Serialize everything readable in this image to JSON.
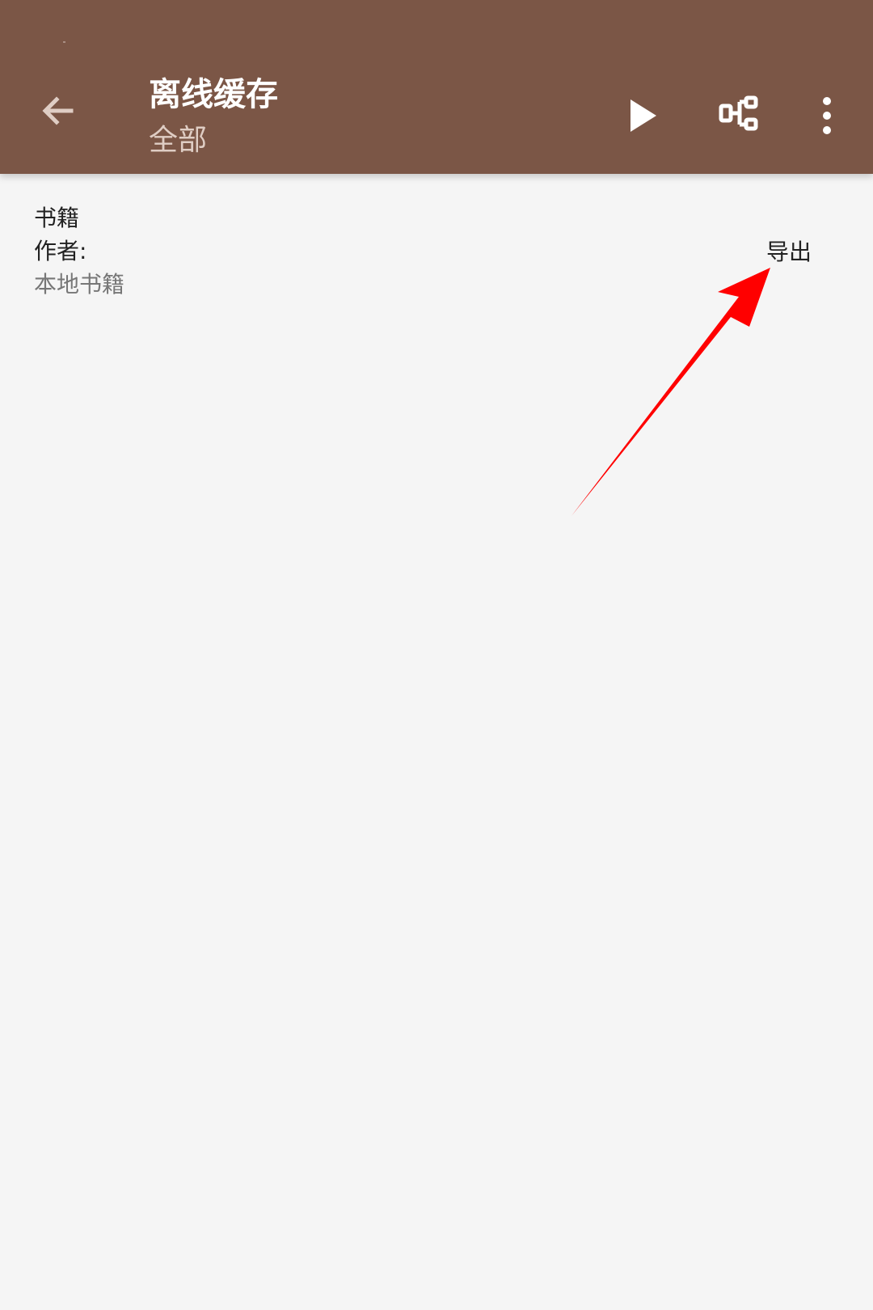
{
  "appbar": {
    "title": "离线缓存",
    "subtitle": "全部"
  },
  "actions": {
    "back_icon": "arrow-left-icon",
    "play_icon": "play-icon",
    "group_icon": "tree-icon",
    "more_icon": "more-vertical-icon"
  },
  "books": [
    {
      "name": "书籍",
      "author_label": "作者:",
      "origin": "本地书籍",
      "export_label": "导出"
    }
  ],
  "colors": {
    "appbar_background": "#7b5646",
    "page_background": "#f5f5f5",
    "annotation_arrow": "#ff0000"
  }
}
